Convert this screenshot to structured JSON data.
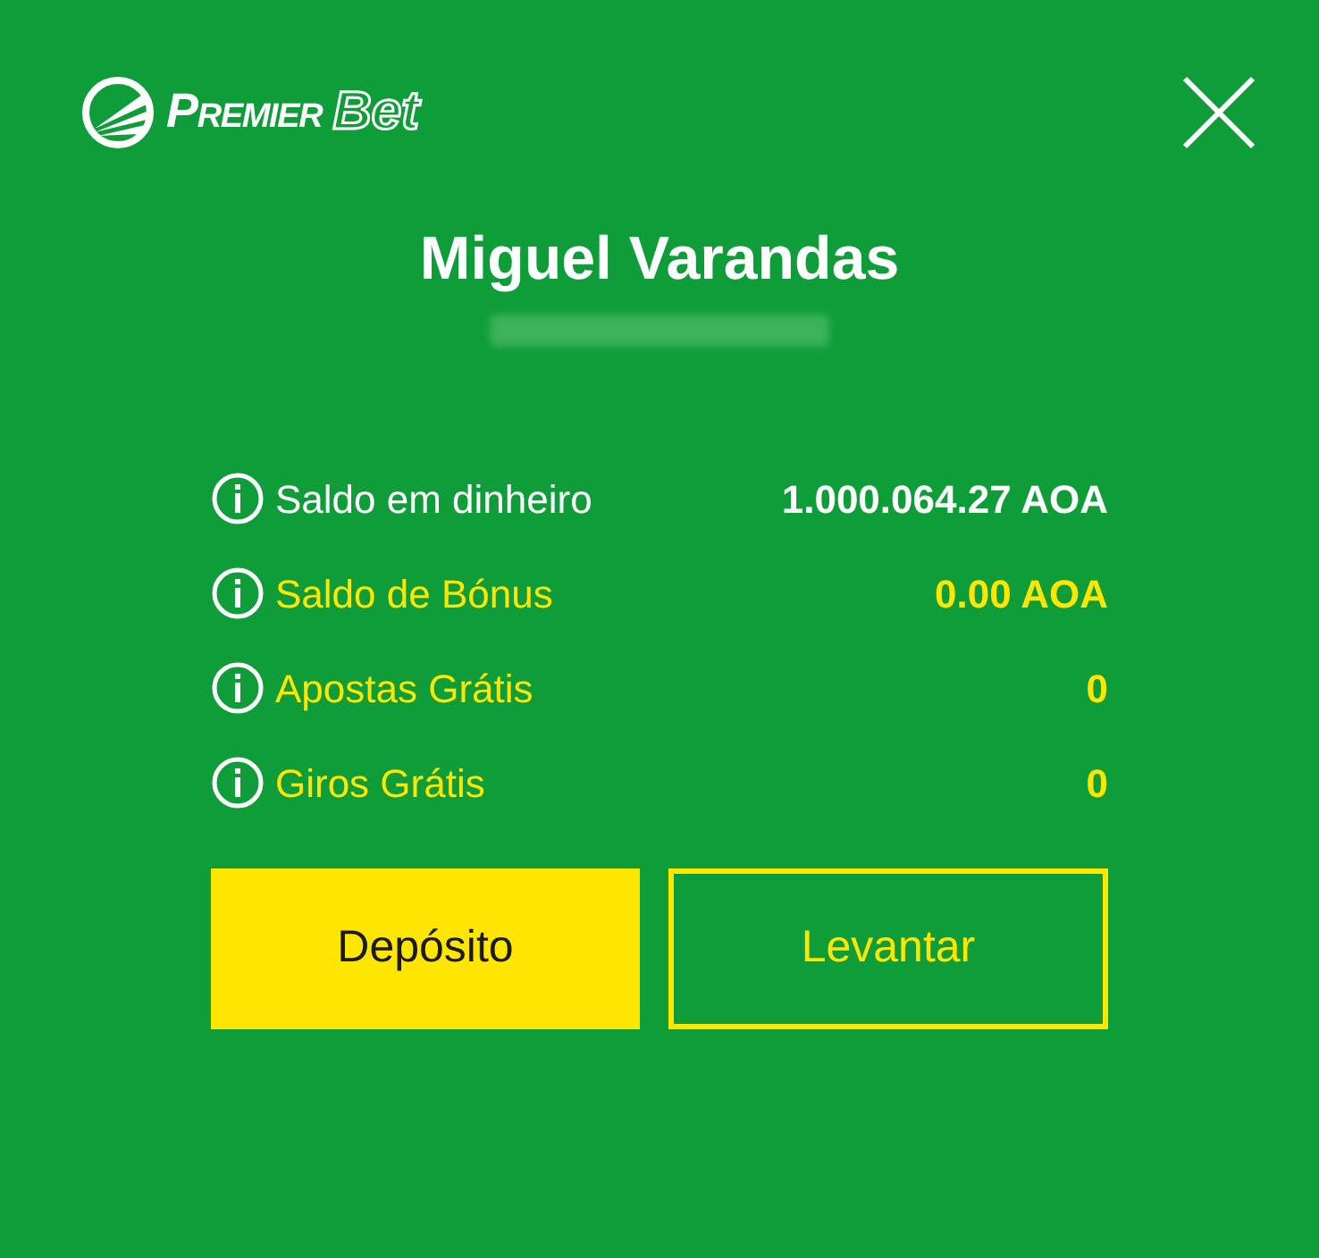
{
  "logo": {
    "word_1": "Premier",
    "word_2": "Bet"
  },
  "user": {
    "name": "Miguel Varandas"
  },
  "balances": [
    {
      "label": "Saldo em dinheiro",
      "value": "1.000.064.27 AOA",
      "color": "#ffffff"
    },
    {
      "label": "Saldo de Bónus",
      "value": "0.00 AOA",
      "color": "#ffe600"
    },
    {
      "label": "Apostas Grátis",
      "value": "0",
      "color": "#ffe600"
    },
    {
      "label": "Giros Grátis",
      "value": "0",
      "color": "#ffe600"
    }
  ],
  "buttons": [
    {
      "label": "Depósito",
      "kind": "filled"
    },
    {
      "label": "Levantar",
      "kind": "outline"
    }
  ]
}
